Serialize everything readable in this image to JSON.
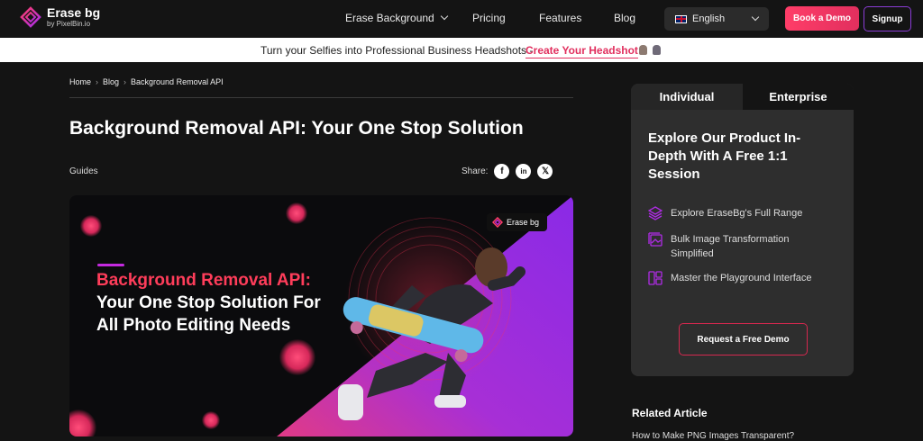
{
  "header": {
    "logo_title": "Erase bg",
    "logo_sub": "by PixelBin.io",
    "nav": [
      "Erase Background",
      "Pricing",
      "Features",
      "Blog"
    ],
    "language": "English",
    "book_demo": "Book a Demo",
    "signup": "Signup"
  },
  "banner": {
    "text": "Turn your Selfies into Professional Business Headshots -",
    "link": "Create Your Headshot"
  },
  "breadcrumb": [
    "Home",
    "Blog",
    "Background Removal API"
  ],
  "article": {
    "title": "Background Removal API: Your One Stop Solution",
    "category": "Guides",
    "share_label": "Share:",
    "share_icons": [
      "facebook-icon",
      "linkedin-icon",
      "x-icon"
    ]
  },
  "hero": {
    "headline_accent": "Background Removal API:",
    "headline_rest": "Your One Stop Solution For All Photo Editing Needs",
    "badge": "Erase bg"
  },
  "sidebar": {
    "tabs": [
      "Individual",
      "Enterprise"
    ],
    "title": "Explore Our Product In-Depth With A Free 1:1 Session",
    "features": [
      "Explore EraseBg's Full Range",
      "Bulk Image Transformation Simplified",
      "Master the Playground Interface"
    ],
    "cta": "Request a Free Demo"
  },
  "related": {
    "heading": "Related Article",
    "first_item": "How to Make PNG Images Transparent?"
  },
  "colors": {
    "accent_pink": "#e12f5e",
    "accent_purple": "#8b3cd6",
    "background": "#141414"
  }
}
